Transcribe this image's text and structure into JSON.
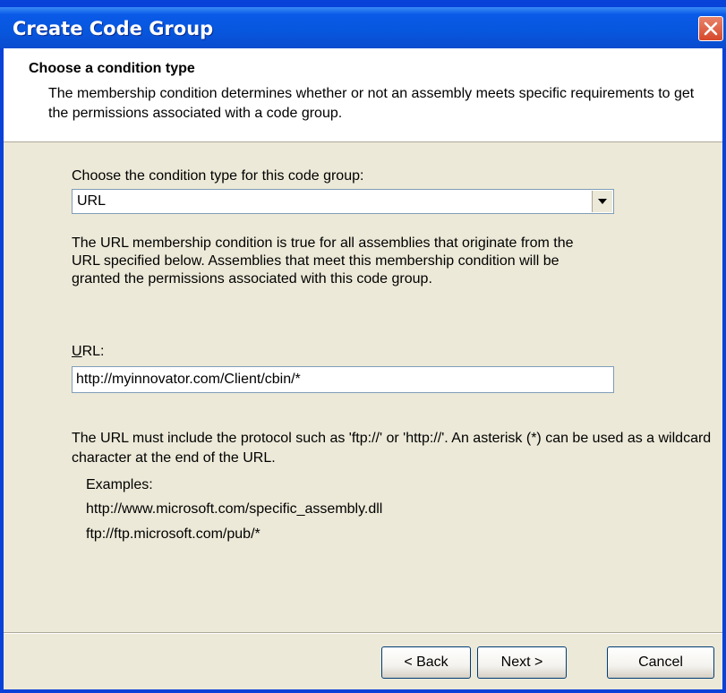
{
  "window": {
    "title": "Create Code Group"
  },
  "header": {
    "title": "Choose a condition type",
    "description": "The membership condition determines whether or not an assembly meets specific requirements to get the permissions associated with a code group."
  },
  "condition": {
    "label": "Choose the condition type for this code group:",
    "selected": "URL",
    "description": "The URL membership condition is true for all assemblies that originate from the URL specified below.  Assemblies that meet this membership condition will be granted the permissions associated with this code group."
  },
  "url": {
    "label_mnemonic": "U",
    "label_rest": "RL:",
    "value": "http://myinnovator.com/Client/cbin/*"
  },
  "note": {
    "text": "The URL must include the protocol such as 'ftp://' or 'http://'.  An asterisk (*) can be used as a wildcard character at the end of the URL.",
    "examples_label": "Examples:",
    "examples": [
      "http://www.microsoft.com/specific_assembly.dll",
      "ftp://ftp.microsoft.com/pub/*"
    ]
  },
  "buttons": {
    "back": "< Back",
    "next": "Next >",
    "cancel": "Cancel"
  },
  "colors": {
    "titlebar": "#0756dd",
    "dialog_background": "#ece9d8",
    "close_button": "#d6482a"
  }
}
